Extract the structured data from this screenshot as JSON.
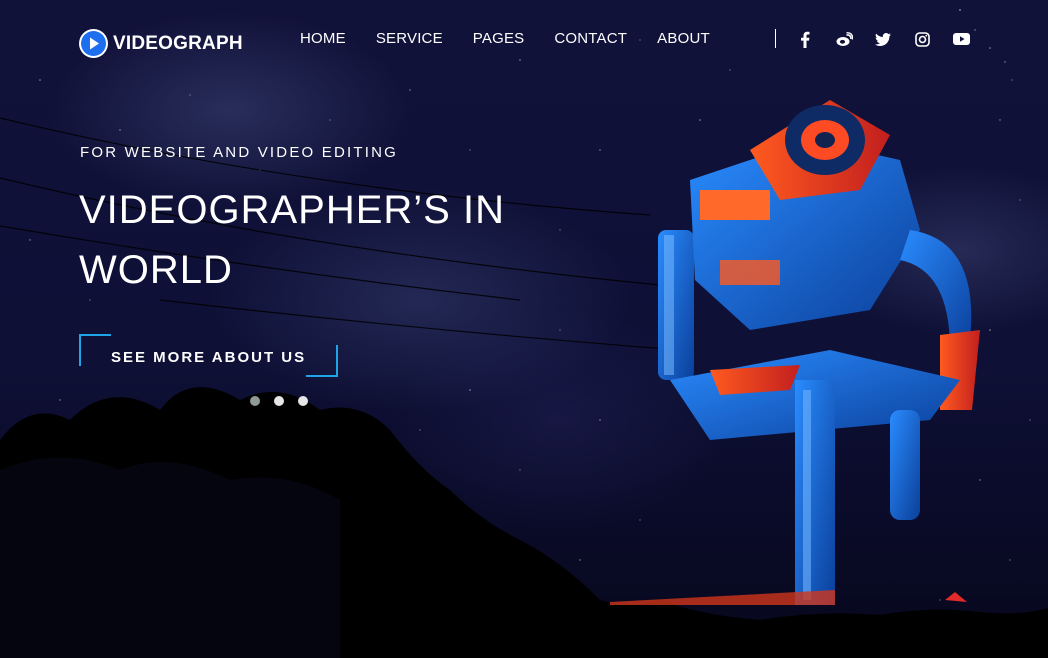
{
  "brand": {
    "name": "VIDEOGRAPH",
    "accent": "#1e6ff0"
  },
  "nav": {
    "items": [
      "HOME",
      "SERVICE",
      "PAGES",
      "CONTACT",
      "ABOUT"
    ]
  },
  "social": [
    "facebook-icon",
    "weibo-icon",
    "twitter-icon",
    "instagram-icon",
    "youtube-icon"
  ],
  "hero": {
    "kicker": "FOR WEBSITE AND VIDEO EDITING",
    "headline": "VIDEOGRAPHER’S IN WORLD",
    "cta_label": "SEE MORE ABOUT US",
    "cta_color": "#1fa4e8"
  },
  "slider": {
    "count": 3,
    "active_index": 0
  }
}
